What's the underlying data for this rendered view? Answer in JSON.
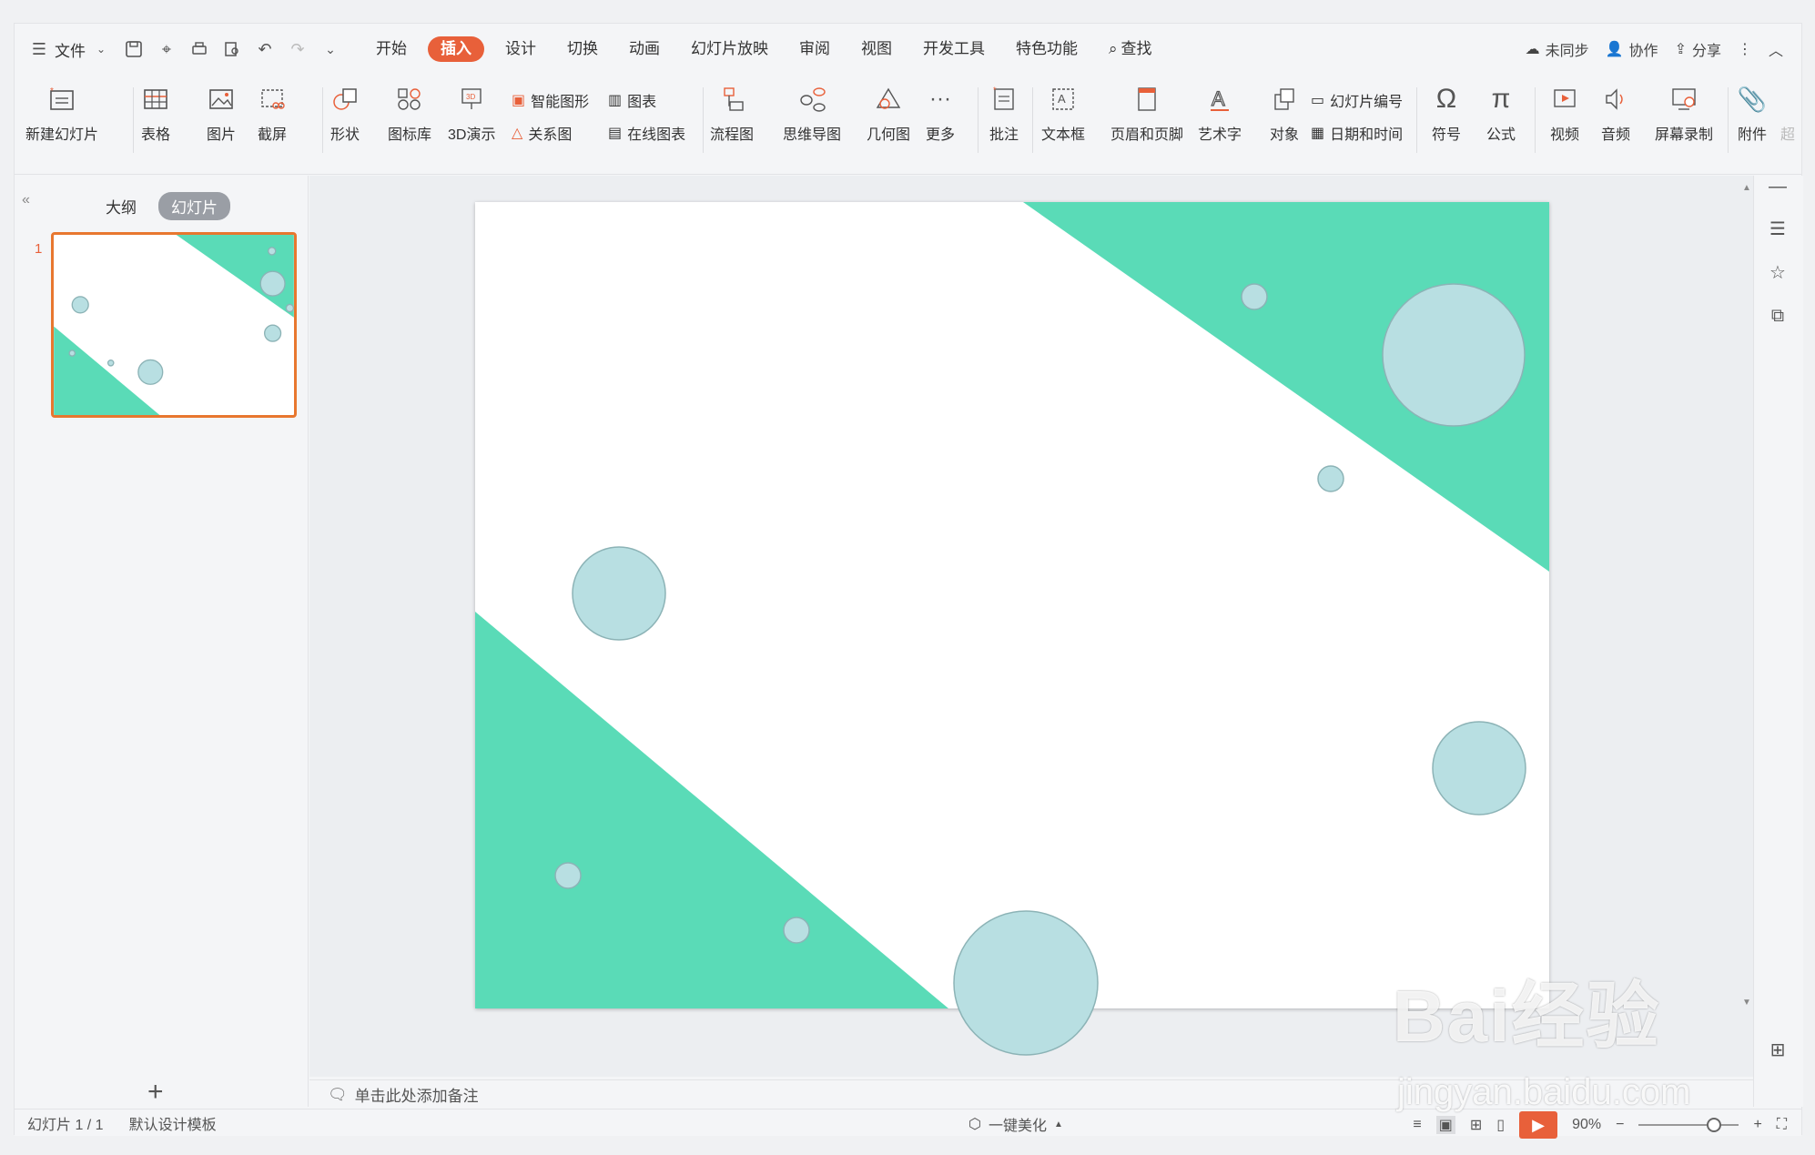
{
  "topbar": {
    "menu_label": "文件",
    "tabs": [
      "开始",
      "插入",
      "设计",
      "切换",
      "动画",
      "幻灯片放映",
      "审阅",
      "视图",
      "开发工具",
      "特色功能"
    ],
    "active_tab": "插入",
    "search_label": "查找",
    "sync_label": "未同步",
    "collab_label": "协作",
    "share_label": "分享"
  },
  "ribbon": {
    "new_slide": "新建幻灯片",
    "table": "表格",
    "picture": "图片",
    "screenshot": "截屏",
    "shape": "形状",
    "icon_lib": "图标库",
    "demo3d": "3D演示",
    "smart_graphic": "智能图形",
    "chart": "图表",
    "relation": "关系图",
    "online_chart": "在线图表",
    "flowchart": "流程图",
    "mindmap": "思维导图",
    "geometry": "几何图",
    "more": "更多",
    "comment": "批注",
    "textbox": "文本框",
    "header_footer": "页眉和页脚",
    "wordart": "艺术字",
    "object": "对象",
    "slide_number": "幻灯片编号",
    "datetime": "日期和时间",
    "symbol": "符号",
    "formula": "公式",
    "video": "视频",
    "audio": "音频",
    "screen_record": "屏幕录制",
    "attachment": "附件",
    "hyperlink_partial": "超"
  },
  "left_panel": {
    "outline_tab": "大纲",
    "slides_tab": "幻灯片",
    "slide_index": "1"
  },
  "notes": {
    "placeholder": "单击此处添加备注"
  },
  "status": {
    "slide_count": "幻灯片 1 / 1",
    "template": "默认设计模板",
    "beautify": "一键美化",
    "zoom": "90%"
  },
  "colors": {
    "accent": "#e8603a",
    "teal": "#5adbb7",
    "bubble": "#b8dfe2",
    "bubble_stroke": "#8cb3b6"
  },
  "watermark": {
    "brand": "Bai经验",
    "url": "jingyan.baidu.com"
  }
}
